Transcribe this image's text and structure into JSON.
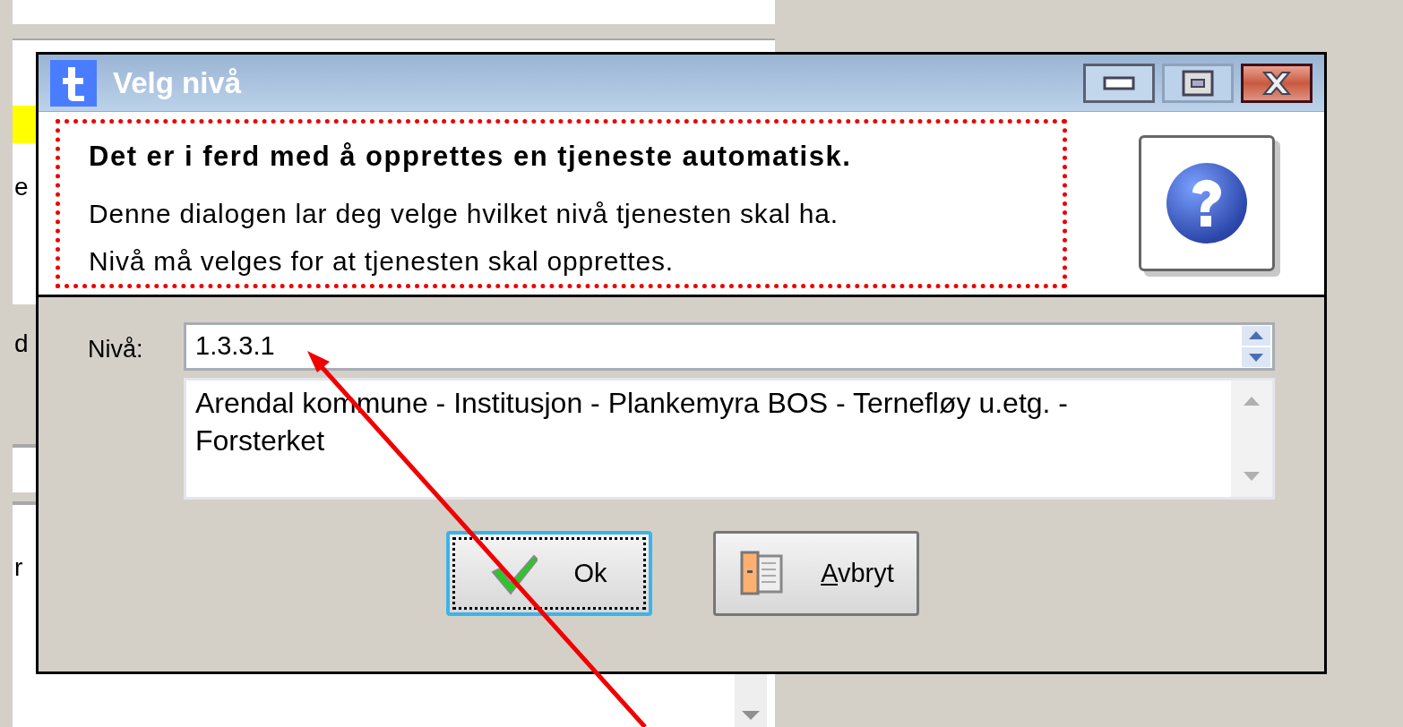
{
  "background_window": {
    "fragments": [
      "e",
      "d",
      "r"
    ]
  },
  "dialog": {
    "title": "Velg nivå",
    "controls": [
      {
        "kind": "minimize"
      },
      {
        "kind": "maximize"
      },
      {
        "kind": "close"
      }
    ],
    "header": {
      "heading": "Det er i ferd med å opprettes en tjeneste automatisk.",
      "lines": [
        "Denne dialogen lar deg velge hvilket nivå tjenesten skal ha.",
        "Nivå må velges for at tjenesten skal opprettes."
      ]
    },
    "level_label": "Nivå:",
    "level_value": "1.3.3.1",
    "description": "Arendal kommune - Institusjon - Plankemyra BOS - Ternefløy u.etg. - Forsterket",
    "buttons": [
      {
        "label": "Ok",
        "kind": "ok",
        "focused": true
      },
      {
        "label": "Avbryt",
        "kind": "cancel",
        "focused": false,
        "first_letter_underlined": true
      }
    ]
  }
}
